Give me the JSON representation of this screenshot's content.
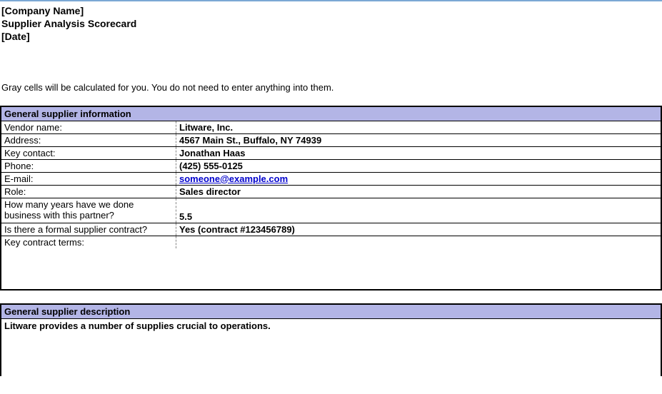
{
  "header": {
    "company": "[Company Name]",
    "title": "Supplier Analysis Scorecard",
    "date": "[Date]"
  },
  "instructions": "Gray cells will be calculated for you. You do not need to enter anything into them.",
  "section1": {
    "title": "General supplier information",
    "rows": [
      {
        "label": "Vendor name:",
        "value": "Litware, Inc."
      },
      {
        "label": "Address:",
        "value": "4567 Main St., Buffalo, NY 74939"
      },
      {
        "label": "Key contact:",
        "value": "Jonathan Haas"
      },
      {
        "label": "Phone:",
        "value": "(425) 555-0125"
      },
      {
        "label": "E-mail:",
        "value": "someone@example.com"
      },
      {
        "label": "Role:",
        "value": "Sales director"
      },
      {
        "label": "How many years have we done business with this partner?",
        "value": "5.5"
      },
      {
        "label": "Is there a formal supplier contract?",
        "value": "Yes (contract #123456789)"
      },
      {
        "label": "Key contract terms:",
        "value": ""
      }
    ]
  },
  "section2": {
    "title": "General supplier description",
    "content": "Litware provides a number of supplies crucial to operations."
  }
}
